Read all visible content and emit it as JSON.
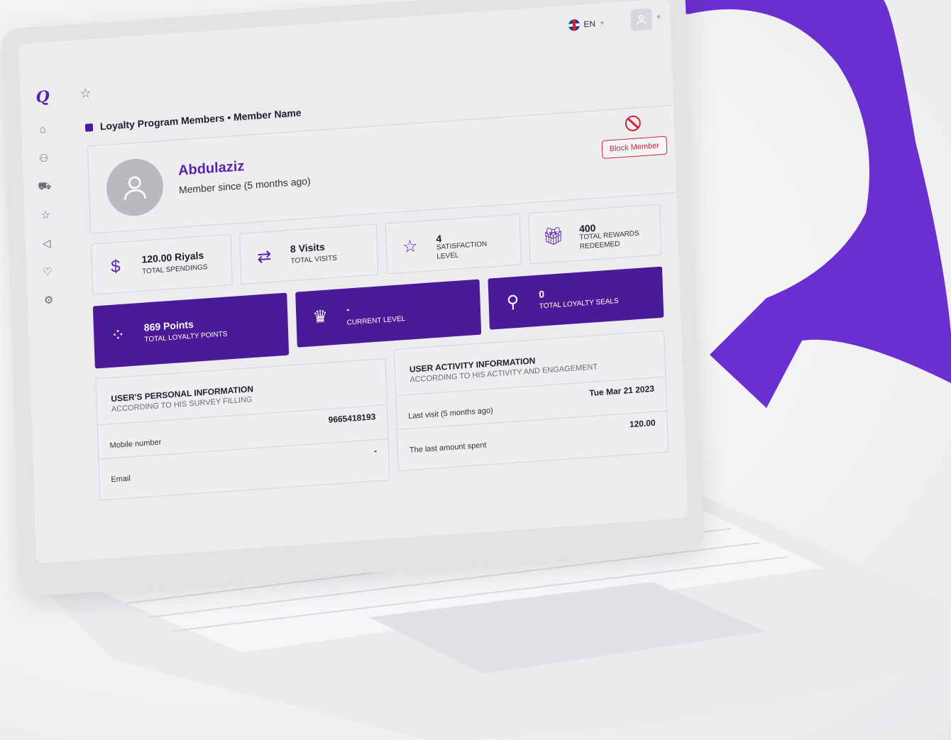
{
  "topbar": {
    "language": "EN"
  },
  "sidebar": {
    "logo": "Q",
    "items": [
      {
        "icon": "home-icon",
        "glyph": "⌂"
      },
      {
        "icon": "members-icon",
        "glyph": "⚇"
      },
      {
        "icon": "cart-icon",
        "glyph": "⛟"
      },
      {
        "icon": "star-icon",
        "glyph": "☆"
      },
      {
        "icon": "megaphone-icon",
        "glyph": "◁"
      },
      {
        "icon": "loyalty-icon",
        "glyph": "♡"
      },
      {
        "icon": "settings-icon",
        "glyph": "⚙"
      }
    ]
  },
  "breadcrumb": "Loyalty Program Members • Member Name",
  "profile": {
    "name": "Abdulaziz",
    "since": "Member since (5 months ago)",
    "block_label": "Block Member"
  },
  "stats": {
    "spendings": {
      "value": "120.00 Riyals",
      "label": "TOTAL SPENDINGS"
    },
    "visits": {
      "value": "8 Visits",
      "label": "TOTAL VISITS"
    },
    "satisfaction": {
      "value": "4",
      "label": "SATISFACTION LEVEL"
    },
    "rewards": {
      "value": "400",
      "label": "TOTAL REWARDS REDEEMED"
    },
    "points": {
      "value": "869 Points",
      "label": "TOTAL LOYALTY POINTS"
    },
    "level": {
      "value": "-",
      "label": "CURRENT LEVEL"
    },
    "seals": {
      "value": "0",
      "label": "TOTAL LOYALTY SEALS"
    }
  },
  "personal": {
    "title": "USER'S PERSONAL INFORMATION",
    "subtitle": "ACCORDING TO HIS SURVEY FILLING",
    "rows": [
      {
        "label": "Mobile number",
        "value": "9665418193"
      },
      {
        "label": "Email",
        "value": "-"
      }
    ]
  },
  "activity": {
    "title": "USER ACTIVITY INFORMATION",
    "subtitle": "ACCORDING TO HIS ACTIVITY AND ENGAGEMENT",
    "rows": [
      {
        "label": "Last visit (5 months ago)",
        "value": "Tue Mar 21 2023"
      },
      {
        "label": "The last amount spent",
        "value": "120.00"
      }
    ]
  },
  "colors": {
    "brand": "#4b1a98",
    "accent": "#6a2fd0",
    "danger": "#d5223a"
  }
}
